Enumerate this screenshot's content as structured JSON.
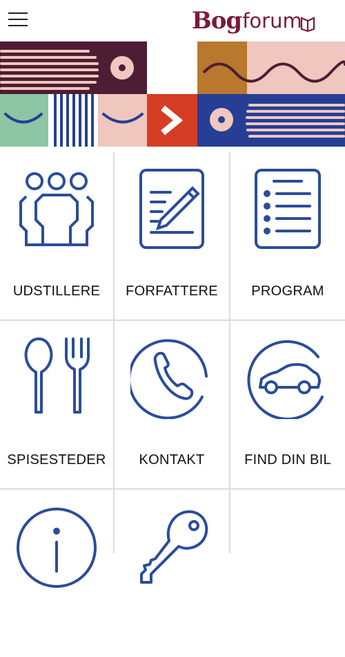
{
  "app": {
    "brand_part1": "Bog",
    "brand_part2": "forum"
  },
  "colors": {
    "brand": "#7a1b3a",
    "icon_blue": "#2a4d9a",
    "banner_maroon": "#4f1d33",
    "banner_pink": "#efc7bf",
    "banner_ochre": "#b8782e",
    "banner_green": "#8cc6a4",
    "banner_red": "#d53d24",
    "banner_navy": "#263f94"
  },
  "menu": [
    {
      "label": "UDSTILLERE",
      "icon": "people-icon"
    },
    {
      "label": "FORFATTERE",
      "icon": "document-pen-icon"
    },
    {
      "label": "PROGRAM",
      "icon": "list-icon"
    },
    {
      "label": "SPISESTEDER",
      "icon": "spoon-fork-icon"
    },
    {
      "label": "KONTAKT",
      "icon": "phone-icon"
    },
    {
      "label": "FIND DIN BIL",
      "icon": "car-icon"
    },
    {
      "label": "",
      "icon": "info-icon"
    },
    {
      "label": "",
      "icon": "key-icon"
    }
  ]
}
